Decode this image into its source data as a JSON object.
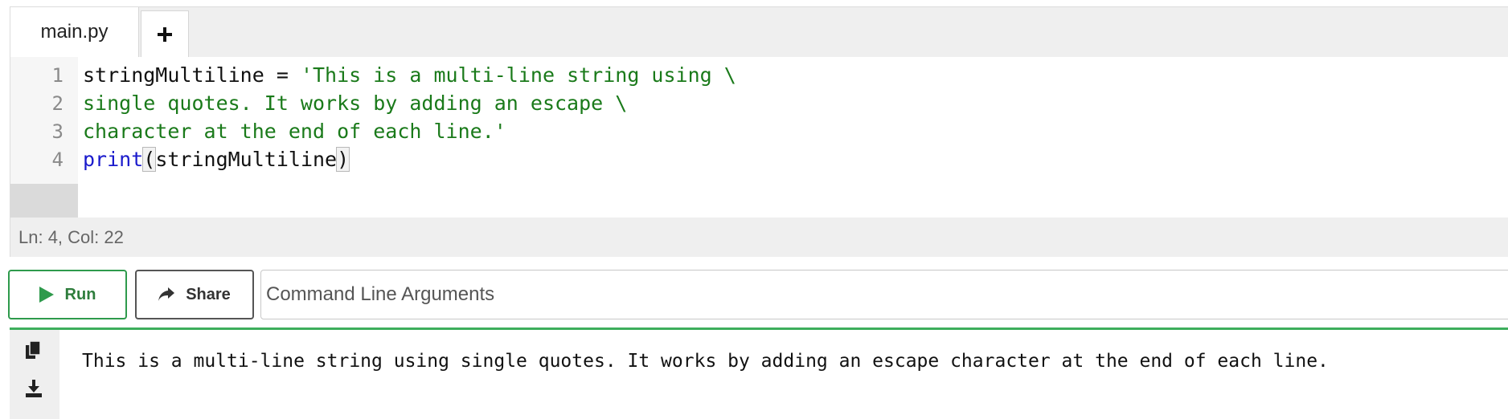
{
  "editor": {
    "tabs": [
      {
        "label": "main.py"
      }
    ],
    "add_tab_icon": "plus-icon",
    "line_numbers": [
      "1",
      "2",
      "3",
      "4"
    ],
    "code_lines": [
      {
        "prefix": "stringMultiline = ",
        "string": "'This is a multi-line string using \\"
      },
      {
        "string": "single quotes. It works by adding an escape \\"
      },
      {
        "string": "character at the end of each line.'"
      },
      {
        "keyword": "print",
        "open": "(",
        "arg": "stringMultiline",
        "close": ")"
      }
    ],
    "status": "Ln: 4,  Col: 22",
    "colors": {
      "string": "#1a7a1a",
      "keyword": "#1a1acc",
      "panel_bg": "#efefef"
    }
  },
  "toolbar": {
    "run_label": "Run",
    "run_icon": "play-icon",
    "share_label": "Share",
    "share_icon": "share-arrow-icon",
    "args_placeholder": "Command Line Arguments",
    "colors": {
      "run": "#2e9a4c"
    }
  },
  "output": {
    "text": "This is a multi-line string using single quotes. It works by adding an escape character at the end of each line.",
    "copy_icon": "copy-icon",
    "download_icon": "download-icon",
    "accent": "#3dae5c"
  }
}
